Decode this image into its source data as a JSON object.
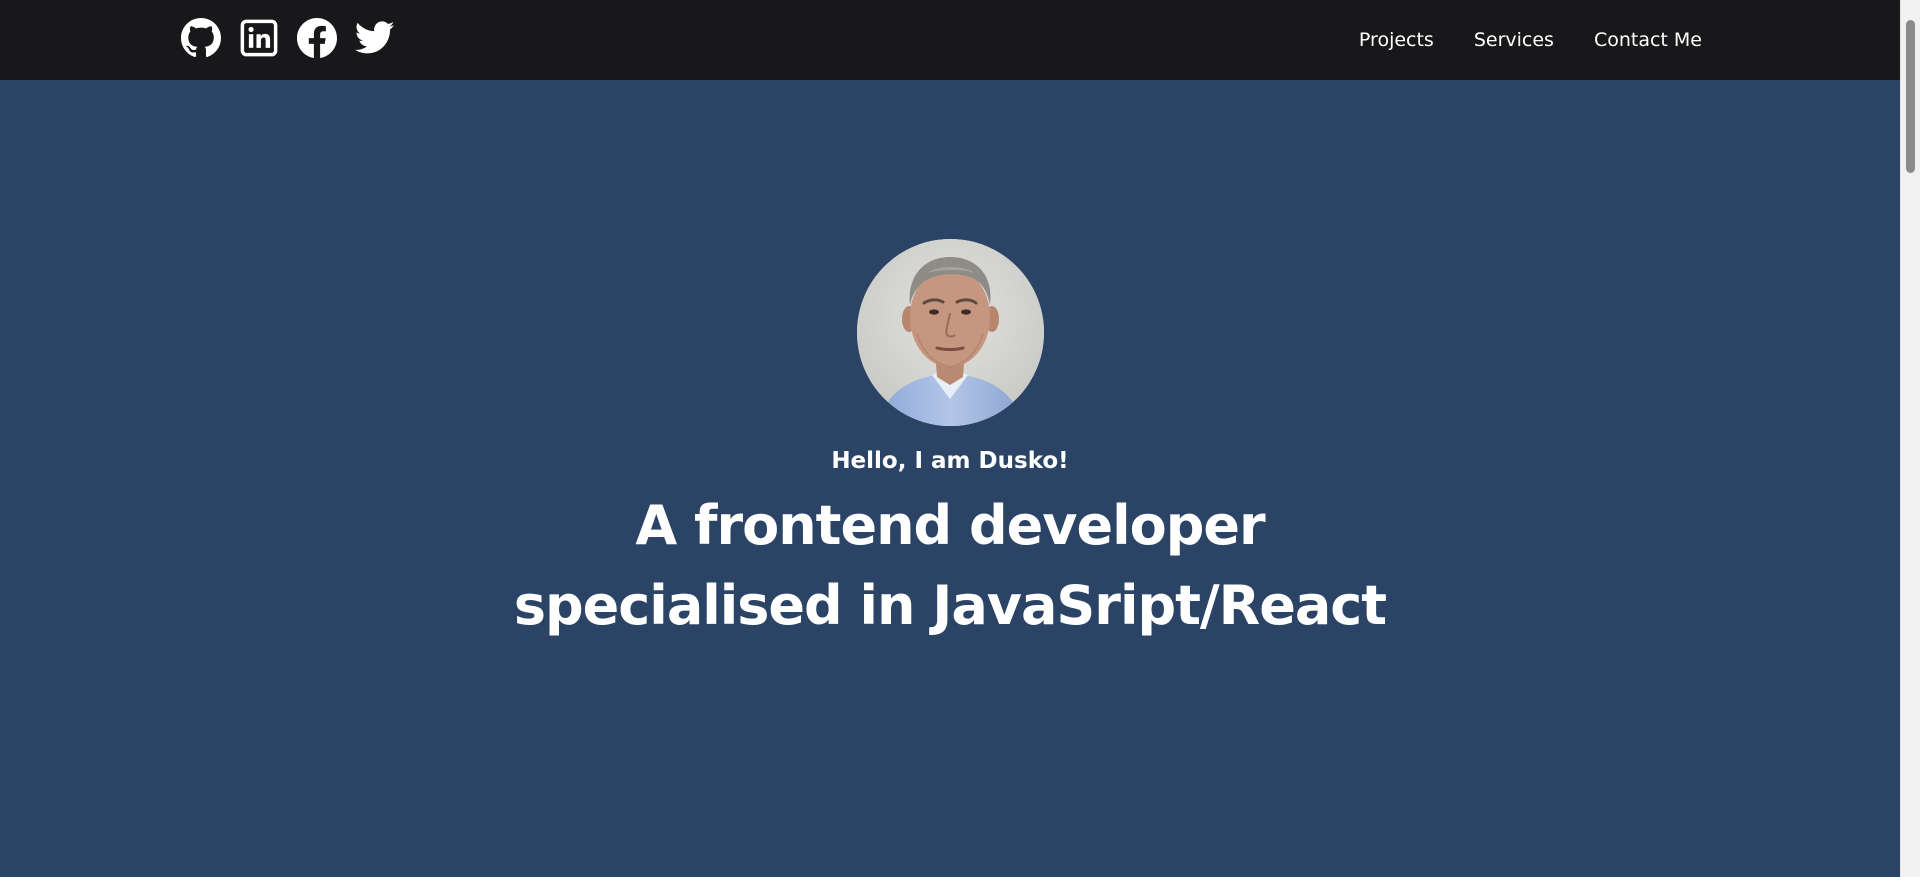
{
  "header": {
    "social_links": [
      {
        "name": "github-icon"
      },
      {
        "name": "linkedin-icon"
      },
      {
        "name": "facebook-icon"
      },
      {
        "name": "twitter-icon"
      }
    ],
    "nav": {
      "projects": "Projects",
      "services": "Services",
      "contact": "Contact Me"
    }
  },
  "hero": {
    "greeting": "Hello, I am Dusko!",
    "headline_line1": "A frontend developer",
    "headline_line2": "specialised in JavaSript/React"
  },
  "colors": {
    "topbar_bg": "#18181b",
    "hero_bg": "#2b4466",
    "text": "#ffffff"
  }
}
